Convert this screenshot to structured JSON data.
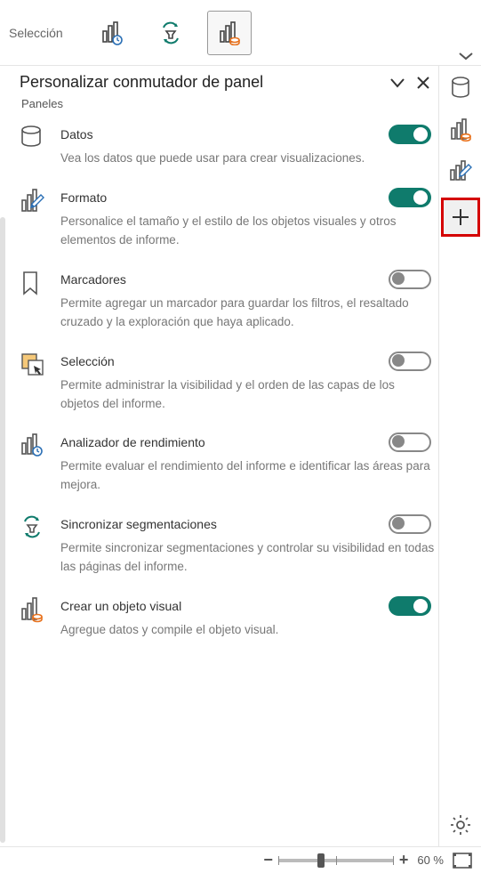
{
  "toolbar": {
    "selection_label": "Selección"
  },
  "panel": {
    "title": "Personalizar conmutador de panel",
    "subtitle": "Paneles"
  },
  "items": {
    "datos": {
      "label": "Datos",
      "desc": "Vea los datos que puede usar para crear visualizaciones.",
      "on": true
    },
    "formato": {
      "label": "Formato",
      "desc": "Personalice el tamaño y el estilo de los objetos visuales y otros elementos de informe.",
      "on": true
    },
    "marcadores": {
      "label": "Marcadores",
      "desc": "Permite agregar un marcador para guardar los filtros, el resaltado cruzado y la exploración que haya aplicado.",
      "on": false
    },
    "seleccion": {
      "label": "Selección",
      "desc": "Permite administrar la visibilidad y el orden de las capas de los objetos del informe.",
      "on": false
    },
    "analizador": {
      "label": "Analizador de rendimiento",
      "desc": "Permite evaluar el rendimiento del informe e identificar las áreas para mejora.",
      "on": false
    },
    "sincronizar": {
      "label": "Sincronizar segmentaciones",
      "desc": "Permite sincronizar segmentaciones y controlar su visibilidad en todas las páginas del informe.",
      "on": false
    },
    "crear": {
      "label": "Crear un objeto visual",
      "desc": "Agregue datos y compile el objeto visual.",
      "on": true
    }
  },
  "status": {
    "zoom_label": "60 %"
  },
  "colors": {
    "accent_on": "#0f7b6c",
    "highlight": "#d40000",
    "orange": "#e8711c"
  }
}
